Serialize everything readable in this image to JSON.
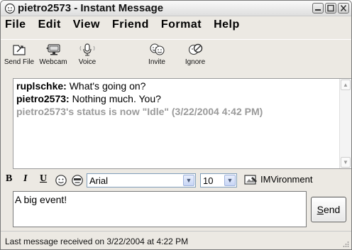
{
  "window": {
    "title": "pietro2573 - Instant Message",
    "title_icon": "messenger-smiley-icon"
  },
  "menu": [
    "File",
    "Edit",
    "View",
    "Friend",
    "Format",
    "Help"
  ],
  "toolbar": {
    "send_file": "Send File",
    "webcam": "Webcam",
    "voice": "Voice",
    "invite": "Invite",
    "ignore": "Ignore"
  },
  "chat": {
    "messages": [
      {
        "sender": "ruplschke:",
        "text": " What's going on?"
      },
      {
        "sender": "pietro2573:",
        "text": " Nothing much. You?"
      }
    ],
    "status_line": "pietro2573's status is now \"Idle\" (3/22/2004 4:42 PM)"
  },
  "format": {
    "bold": "B",
    "italic": "I",
    "underline": "U",
    "font": "Arial",
    "size": "10",
    "imvironment": "IMVironment"
  },
  "input": {
    "value": "A big event!"
  },
  "send": {
    "label_underlined": "S",
    "label_rest": "end"
  },
  "status_bar": {
    "text": "Last message received on 3/22/2004 at 4:22 PM"
  },
  "colors": {
    "status_gray": "#9a9a9a",
    "window_bg": "#ece9e3"
  }
}
